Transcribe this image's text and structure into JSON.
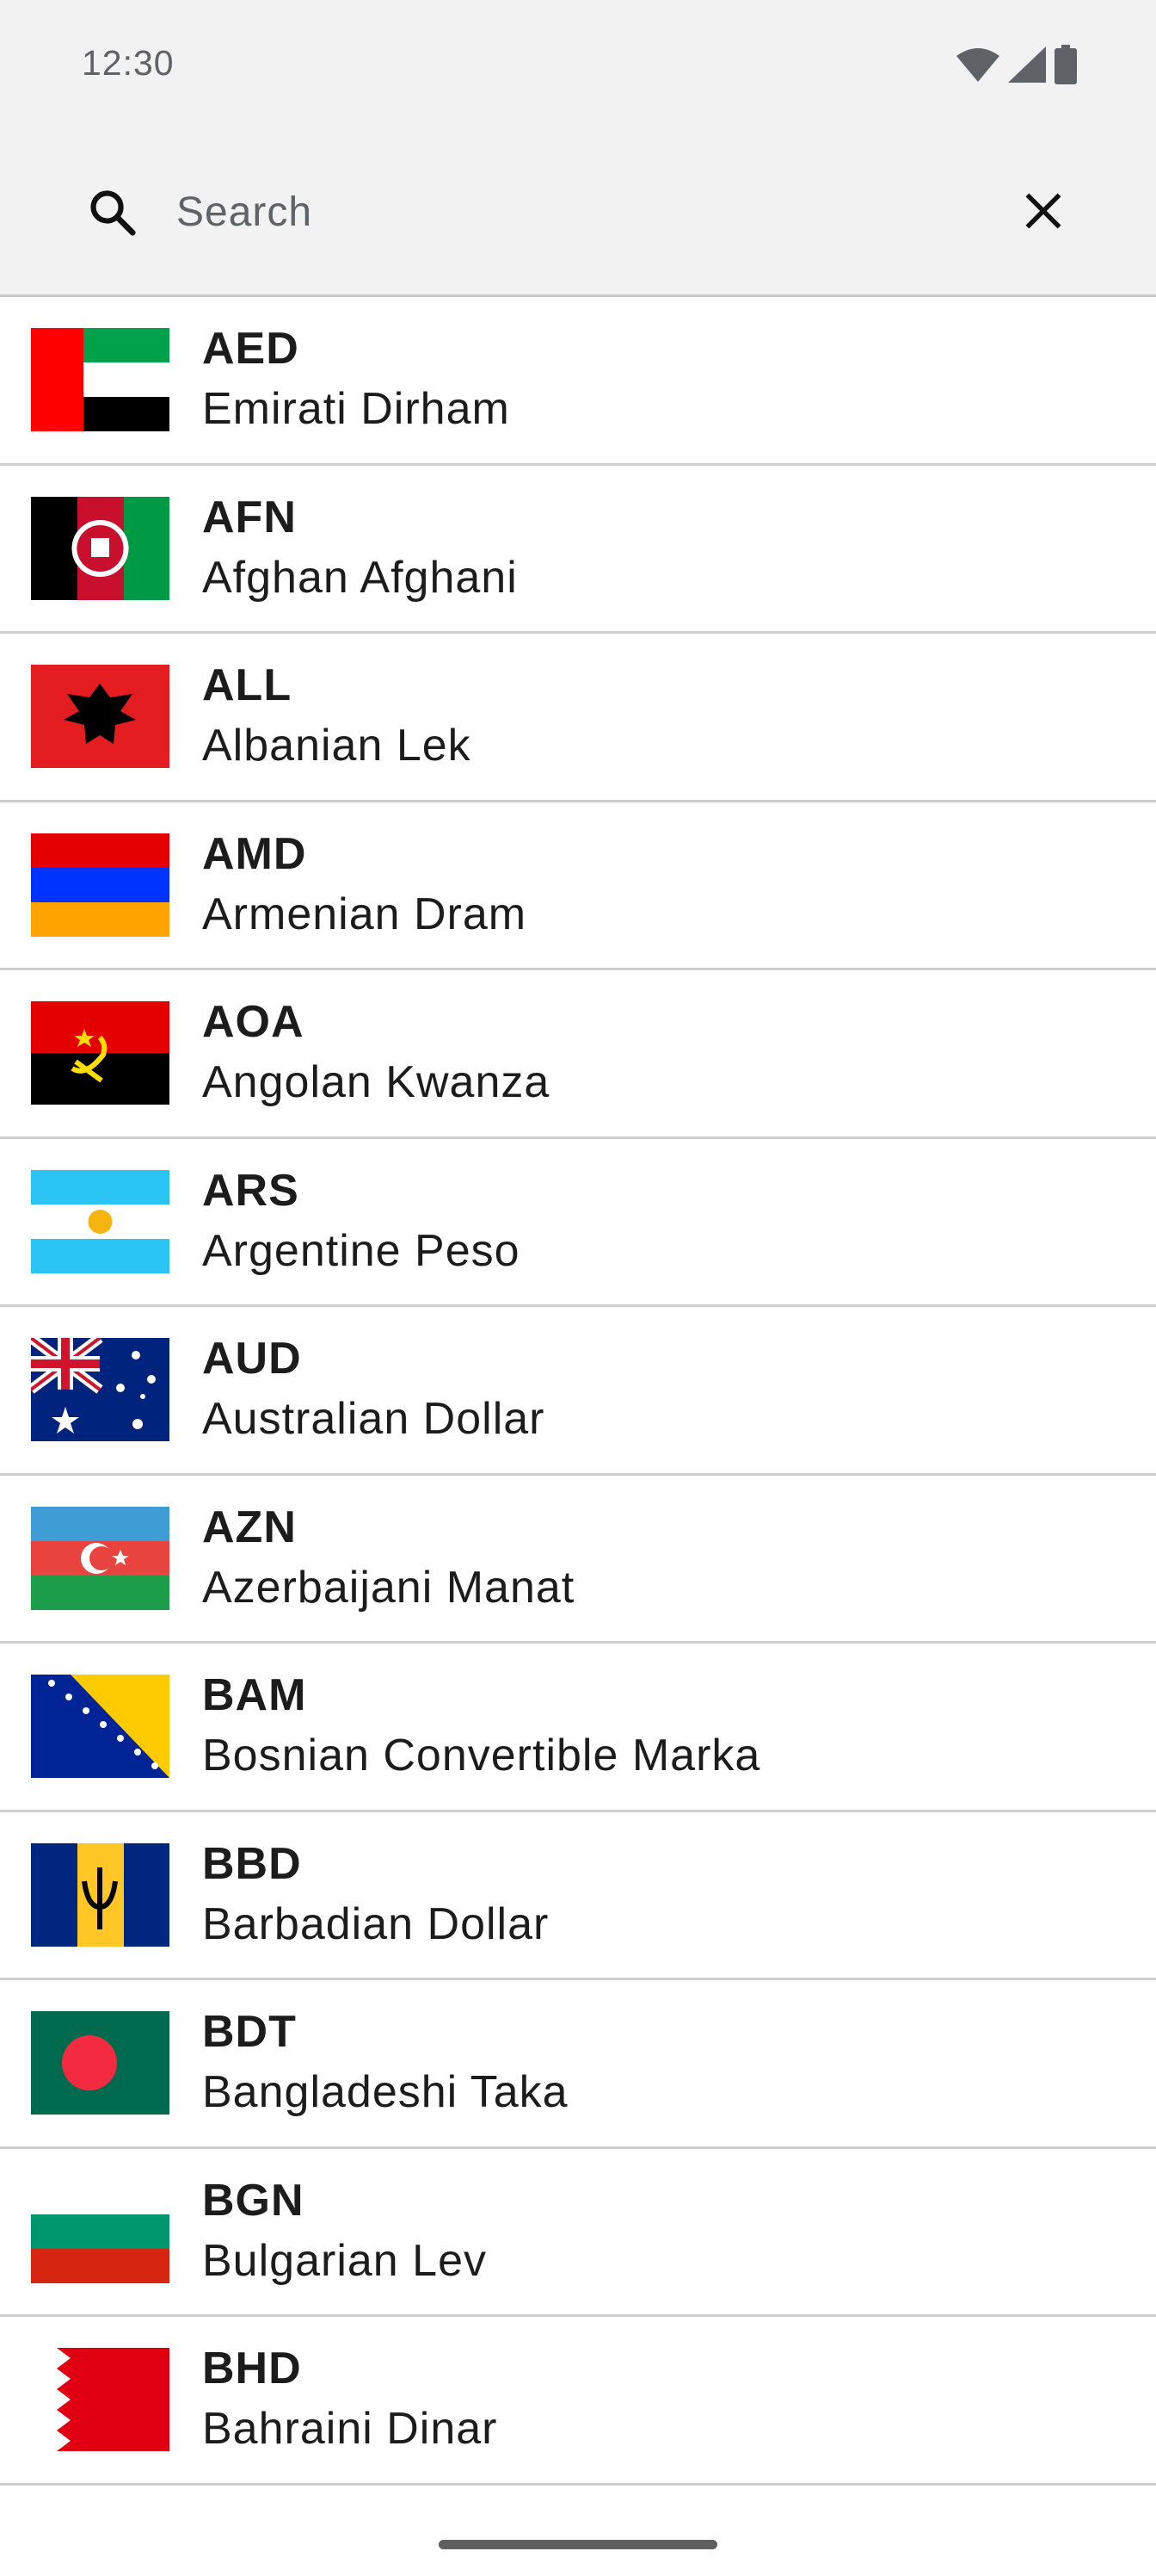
{
  "status_bar": {
    "time": "12:30",
    "icons": [
      "wifi-icon",
      "cellular-signal-icon",
      "battery-icon"
    ]
  },
  "search": {
    "placeholder": "Search",
    "value": "",
    "search_icon": "search-icon",
    "clear_icon": "close-icon"
  },
  "currencies": [
    {
      "code": "AED",
      "name": "Emirati Dirham",
      "flag": "uae-flag-icon"
    },
    {
      "code": "AFN",
      "name": "Afghan Afghani",
      "flag": "afghanistan-flag-icon"
    },
    {
      "code": "ALL",
      "name": "Albanian Lek",
      "flag": "albania-flag-icon"
    },
    {
      "code": "AMD",
      "name": "Armenian Dram",
      "flag": "armenia-flag-icon"
    },
    {
      "code": "AOA",
      "name": "Angolan Kwanza",
      "flag": "angola-flag-icon"
    },
    {
      "code": "ARS",
      "name": "Argentine Peso",
      "flag": "argentina-flag-icon"
    },
    {
      "code": "AUD",
      "name": "Australian Dollar",
      "flag": "australia-flag-icon"
    },
    {
      "code": "AZN",
      "name": "Azerbaijani Manat",
      "flag": "azerbaijan-flag-icon"
    },
    {
      "code": "BAM",
      "name": "Bosnian Convertible Marka",
      "flag": "bosnia-flag-icon"
    },
    {
      "code": "BBD",
      "name": "Barbadian Dollar",
      "flag": "barbados-flag-icon"
    },
    {
      "code": "BDT",
      "name": "Bangladeshi Taka",
      "flag": "bangladesh-flag-icon"
    },
    {
      "code": "BGN",
      "name": "Bulgarian Lev",
      "flag": "bulgaria-flag-icon"
    },
    {
      "code": "BHD",
      "name": "Bahraini Dinar",
      "flag": "bahrain-flag-icon"
    }
  ]
}
